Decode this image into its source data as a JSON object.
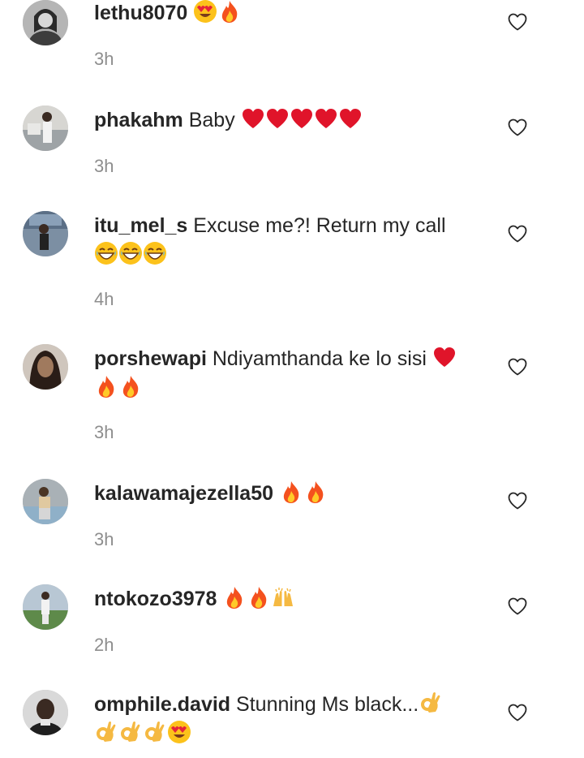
{
  "comments": [
    {
      "username": "lethu8070",
      "text": "",
      "emojis_inline": [
        "heart-eyes",
        "fire"
      ],
      "emojis_line2": [],
      "time": "3h",
      "avatar_color": "#9a9a9a"
    },
    {
      "username": "phakahm",
      "text": "Baby",
      "emojis_inline": [
        "red-heart",
        "red-heart",
        "red-heart",
        "red-heart",
        "red-heart"
      ],
      "emojis_line2": [],
      "time": "3h",
      "avatar_color": "#c9c9c4"
    },
    {
      "username": "itu_mel_s",
      "text": "Excuse me?! Return my call",
      "emojis_inline": [],
      "emojis_line2": [
        "grinning-sweat",
        "grinning-sweat",
        "grinning-sweat"
      ],
      "time": "4h",
      "avatar_color": "#5a6f88"
    },
    {
      "username": "porshewapi",
      "text": "Ndiyamthanda ke lo sisi",
      "emojis_inline": [
        "red-heart"
      ],
      "emojis_line2": [
        "fire",
        "fire"
      ],
      "time": "3h",
      "avatar_color": "#4a3b33"
    },
    {
      "username": "kalawamajezella50",
      "text": "",
      "emojis_inline": [
        "fire",
        "fire"
      ],
      "emojis_line2": [],
      "time": "3h",
      "avatar_color": "#8a9298"
    },
    {
      "username": "ntokozo3978",
      "text": "",
      "emojis_inline": [
        "fire",
        "fire",
        "raising-hands"
      ],
      "emojis_line2": [],
      "time": "2h",
      "avatar_color": "#6e8a5a"
    },
    {
      "username": "omphile.david",
      "text": "Stunning Ms black...",
      "emojis_inline": [
        "ok-hand"
      ],
      "emojis_line2": [
        "ok-hand",
        "ok-hand",
        "ok-hand",
        "heart-eyes"
      ],
      "time": "",
      "avatar_color": "#3a3a3a"
    }
  ],
  "colors": {
    "username": "#262626",
    "timestamp": "#8e8e8e",
    "heart_outline": "#262626"
  },
  "icons": {
    "like": "heart-outline-icon"
  }
}
